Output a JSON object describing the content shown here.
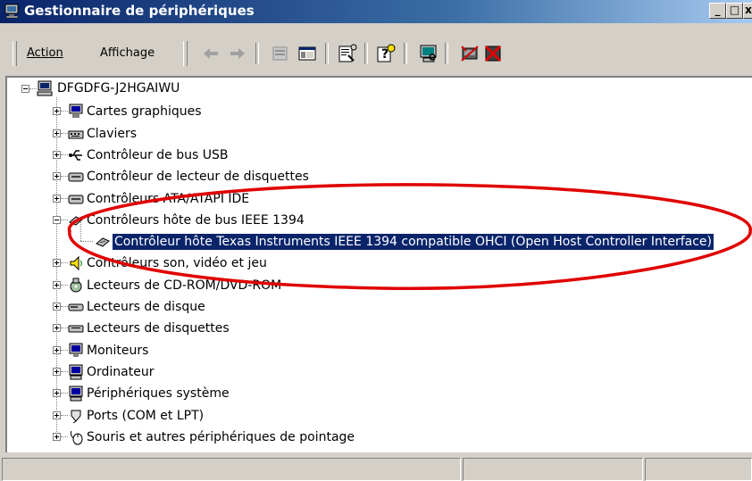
{
  "window": {
    "title": "Gestionnaire de périphériques"
  },
  "menu": {
    "action": "Action",
    "view": "Affichage"
  },
  "toolbar": [
    "back-arrow-icon",
    "forward-arrow-icon",
    "up-folder-icon",
    "show-hide-tree-icon",
    "properties-icon",
    "help-icon",
    "scan-hardware-icon",
    "update-driver-icon",
    "uninstall-icon"
  ],
  "tree": {
    "root": "DFGDFG-J2HGAIWU",
    "items": [
      {
        "label": "Cartes graphiques",
        "icon": "display-adapter-icon"
      },
      {
        "label": "Claviers",
        "icon": "keyboard-icon"
      },
      {
        "label": "Contrôleur de bus USB",
        "icon": "usb-icon"
      },
      {
        "label": "Contrôleur de lecteur de disquettes",
        "icon": "floppy-controller-icon"
      },
      {
        "label": "Contrôleurs ATA/ATAPI IDE",
        "icon": "ide-controller-icon"
      },
      {
        "label": "Contrôleurs hôte de bus IEEE 1394",
        "icon": "ieee1394-icon"
      },
      {
        "label": "Contrôleur hôte Texas Instruments IEEE 1394 compatible OHCI (Open Host Controller Interface)",
        "icon": "ieee1394-device-icon"
      },
      {
        "label": "Contrôleurs son, vidéo et jeu",
        "icon": "sound-icon"
      },
      {
        "label": "Lecteurs de CD-ROM/DVD-ROM",
        "icon": "cdrom-icon"
      },
      {
        "label": "Lecteurs de disque",
        "icon": "hard-disk-icon"
      },
      {
        "label": "Lecteurs de disquettes",
        "icon": "floppy-drive-icon"
      },
      {
        "label": "Moniteurs",
        "icon": "monitor-icon"
      },
      {
        "label": "Ordinateur",
        "icon": "computer-icon"
      },
      {
        "label": "Périphériques système",
        "icon": "system-devices-icon"
      },
      {
        "label": "Ports (COM et LPT)",
        "icon": "ports-icon"
      },
      {
        "label": "Souris et autres périphériques de pointage",
        "icon": "mouse-icon"
      }
    ]
  },
  "colors": {
    "title_start": "#0a246a",
    "title_end": "#a6caf0",
    "selection": "#0a246a",
    "annotation": "#e00000"
  }
}
